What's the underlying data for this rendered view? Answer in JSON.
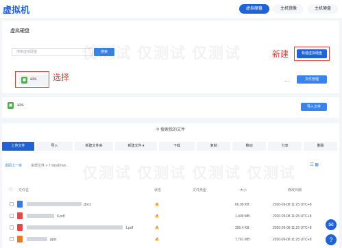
{
  "app": {
    "title": "虚拟机"
  },
  "tabs": [
    "虚拟硬盘",
    "主机镜像",
    "主机硬盘"
  ],
  "panel1": {
    "title": "虚拟硬盘",
    "search_placeholder": "搜索虚拟硬盘",
    "search_button": "搜索",
    "annotation_new": "新建",
    "new_disk_button": "新建虚拟硬盘",
    "disk_name": "abs",
    "annotation_select": "选择",
    "more": "...",
    "file_mgmt_button": "文件管理"
  },
  "panel2": {
    "disk_name": "abs",
    "import_button": "导入文件"
  },
  "file_panel": {
    "search_label": "搜索我的文件",
    "toolbar": [
      "上传文件",
      "导入",
      "新建文件夹",
      "新建文件 ▾",
      "下载",
      "复制",
      "移动",
      "分享",
      "删除"
    ],
    "breadcrumb_back": "返回上一级",
    "breadcrumb_path": "全部文件 > 7  dataDrive...",
    "columns": [
      "文件名",
      "状态",
      "文件类型",
      "大小",
      "修改日期"
    ],
    "rows": [
      {
        "name": ".docx",
        "size": "60.99 KB",
        "date": "2020-09-08 11:25 UTC+8",
        "icon_color": "#3a7be0"
      },
      {
        "name": "6.pdf",
        "size": "1.490 MB",
        "date": "2020-09-08 11:25 UTC+8",
        "icon_color": "#e04a4a"
      },
      {
        "name": "1.pdf",
        "size": "395.4 KB",
        "date": "2020-09-08 11:25 UTC+8",
        "icon_color": "#e04a4a"
      },
      {
        "name": "pptx",
        "size": "7.761 MB",
        "date": "2020-09-08 11:25 UTC+8",
        "icon_color": "#e87a2e"
      }
    ]
  },
  "watermark": "仅测试"
}
